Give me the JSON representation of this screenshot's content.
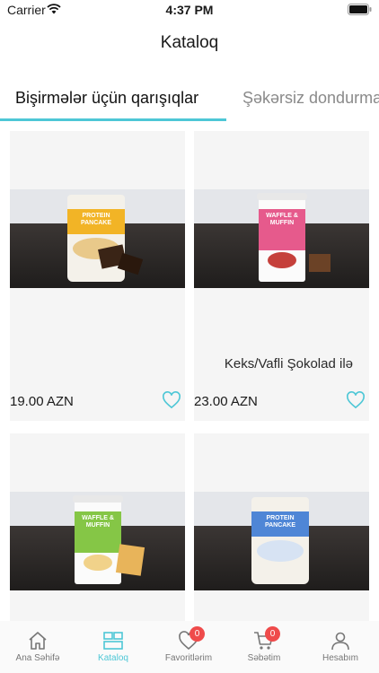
{
  "status": {
    "carrier": "Carrier",
    "time": "4:37 PM"
  },
  "header": {
    "title": "Kataloq"
  },
  "category_tabs": [
    {
      "label": "Bişirmələr üçün qarışıqlar",
      "active": true
    },
    {
      "label": "Şəkərsiz dondurma",
      "active": false
    }
  ],
  "products": [
    {
      "name": "",
      "price": "19.00 AZN",
      "image": "pancake-pouch",
      "favorite": false
    },
    {
      "name": "Keks/Vafli Şokolad ilə",
      "price": "23.00 AZN",
      "image": "waffle-muffin-chocolate-can",
      "favorite": false
    },
    {
      "name": "",
      "price": "",
      "image": "waffle-muffin-vanilla-can",
      "favorite": false
    },
    {
      "name": "",
      "price": "",
      "image": "pancake-pouch-blue",
      "favorite": false
    }
  ],
  "product_image_text": {
    "pouch": "PROTEIN PANCAKE",
    "can": "WAFFLE & MUFFIN"
  },
  "tab_bar": [
    {
      "label": "Ana Səhifə",
      "icon": "home-icon",
      "active": false
    },
    {
      "label": "Kataloq",
      "icon": "catalog-icon",
      "active": true
    },
    {
      "label": "Favoritlərim",
      "icon": "heart-icon",
      "active": false,
      "badge": "0"
    },
    {
      "label": "Səbətim",
      "icon": "cart-icon",
      "active": false,
      "badge": "0"
    },
    {
      "label": "Hesabım",
      "icon": "person-icon",
      "active": false
    }
  ],
  "colors": {
    "accent": "#4ec7d6",
    "badge": "#ef4b4b",
    "card_bg": "#f5f5f5"
  }
}
